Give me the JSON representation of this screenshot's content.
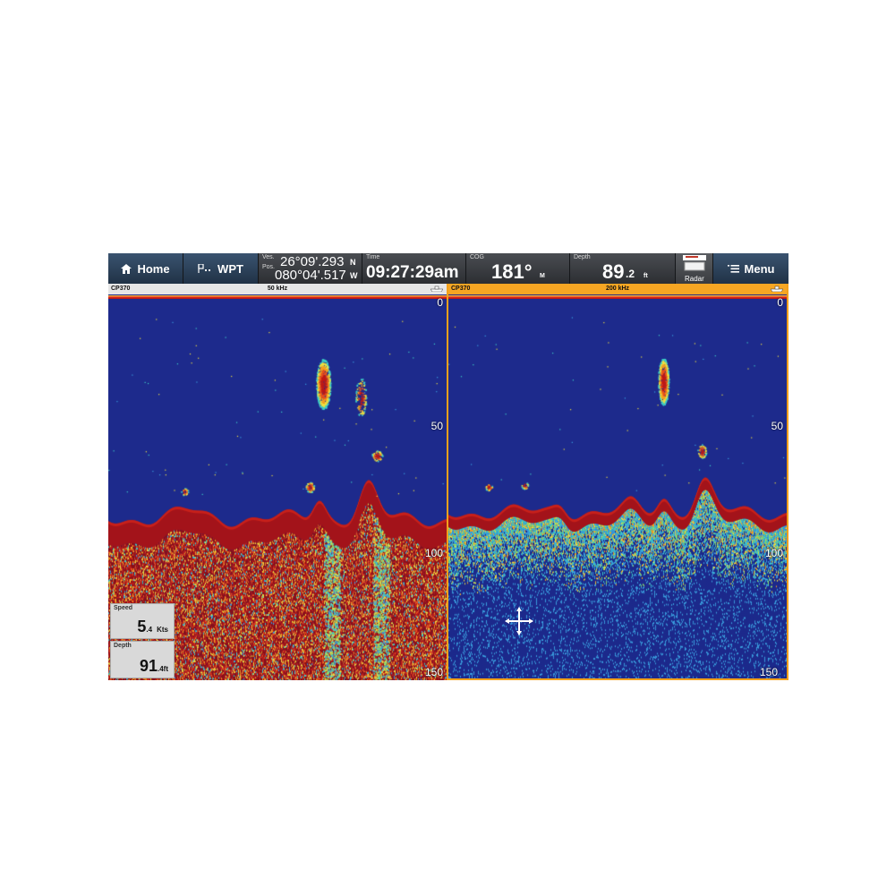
{
  "topbar": {
    "home_label": "Home",
    "wpt_label": "WPT",
    "position": {
      "ves_label": "Ves.",
      "pos_label": "Pos.",
      "lat": "26°09'.293",
      "lat_dir": "N",
      "lon": "080°04'.517",
      "lon_dir": "W"
    },
    "time": {
      "label": "Time",
      "value": "09:27:29am"
    },
    "cog": {
      "label": "COG",
      "value": "181°",
      "unit": "M"
    },
    "depth": {
      "label": "Depth",
      "value": "89",
      "decimal": ".2",
      "unit": "ft"
    },
    "radar_label": "Radar",
    "menu_label": "Menu"
  },
  "left_panel": {
    "model": "CP370",
    "frequency": "50 kHz",
    "scale": [
      "0",
      "50",
      "100",
      "150"
    ],
    "speed": {
      "label": "Speed",
      "value": "5",
      "decimal": ".4",
      "unit": "Kts"
    },
    "depth": {
      "label": "Depth",
      "value": "91",
      "decimal": ".4",
      "unit": "ft"
    }
  },
  "right_panel": {
    "model": "CP370",
    "frequency": "200 kHz",
    "scale": [
      "0",
      "50",
      "100",
      "150"
    ]
  },
  "colors": {
    "water": "#1d2a8c",
    "bottom": "#a3131a",
    "active_border": "#f2a01b",
    "header": "#2c2e32"
  }
}
